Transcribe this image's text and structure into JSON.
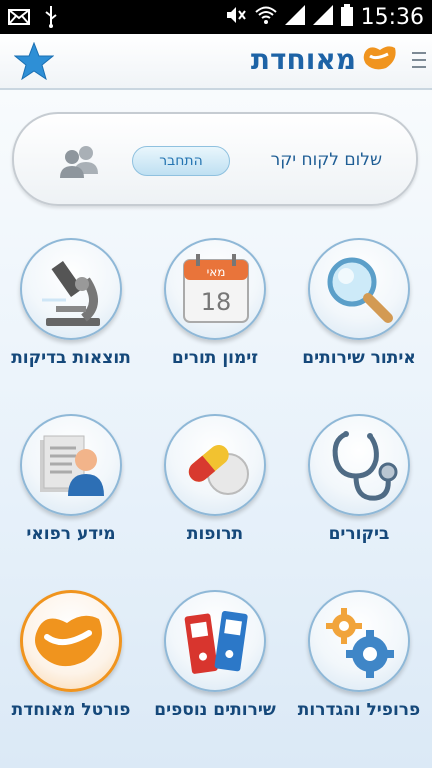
{
  "status_bar": {
    "time": "15:36"
  },
  "header": {
    "logo_text": "מאוחדת"
  },
  "welcome": {
    "greeting": "שלום לקוח יקר",
    "login_label": "התחבר"
  },
  "tiles": [
    {
      "label": "איתור שירותים",
      "icon": "magnifier-icon"
    },
    {
      "label": "זימון תורים",
      "icon": "calendar-icon",
      "calendar_month": "מאי",
      "calendar_day": "18"
    },
    {
      "label": "תוצאות בדיקות",
      "icon": "microscope-icon"
    },
    {
      "label": "ביקורים",
      "icon": "stethoscope-icon"
    },
    {
      "label": "תרופות",
      "icon": "pills-icon"
    },
    {
      "label": "מידע רפואי",
      "icon": "medical-record-icon"
    },
    {
      "label": "פרופיל והגדרות",
      "icon": "gears-icon"
    },
    {
      "label": "שירותים נוספים",
      "icon": "binders-icon"
    },
    {
      "label": "פורטל מאוחדת",
      "icon": "meuhedet-logo-icon"
    }
  ],
  "colors": {
    "brand_blue": "#1d63a6",
    "brand_orange": "#f0941e",
    "label_blue": "#15487a"
  }
}
